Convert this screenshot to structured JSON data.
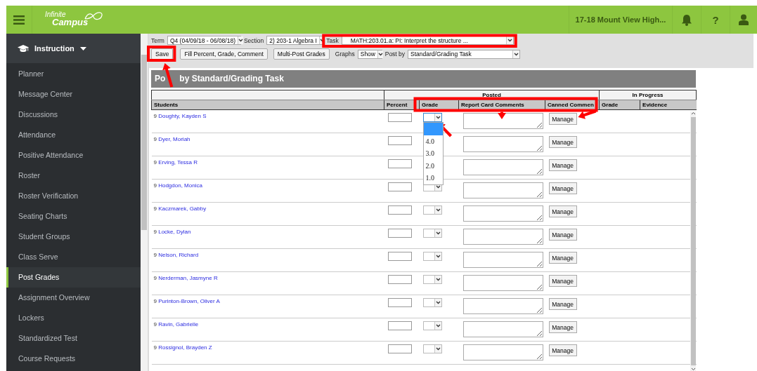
{
  "header": {
    "logo_lines": [
      "Infinite",
      "Campus"
    ],
    "school": "17-18 Mount View High...",
    "help": "?"
  },
  "sidebar": {
    "module": "Instruction",
    "items": [
      {
        "label": "Planner",
        "selected": false
      },
      {
        "label": "Message Center",
        "selected": false
      },
      {
        "label": "Discussions",
        "selected": false
      },
      {
        "label": "Attendance",
        "selected": false
      },
      {
        "label": "Positive Attendance",
        "selected": false
      },
      {
        "label": "Roster",
        "selected": false
      },
      {
        "label": "Roster Verification",
        "selected": false
      },
      {
        "label": "Seating Charts",
        "selected": false
      },
      {
        "label": "Student Groups",
        "selected": false
      },
      {
        "label": "Class Serve",
        "selected": false
      },
      {
        "label": "Post Grades",
        "selected": true
      },
      {
        "label": "Assignment Overview",
        "selected": false
      },
      {
        "label": "Lockers",
        "selected": false
      },
      {
        "label": "Standardized Test",
        "selected": false
      },
      {
        "label": "Course Requests",
        "selected": false
      }
    ]
  },
  "toolbar": {
    "term": {
      "label": "Term",
      "value": "Q4 (04/09/18 - 06/08/18)"
    },
    "section": {
      "label": "Section",
      "value": "2) 203-1 Algebra I"
    },
    "task": {
      "label": "Task",
      "value": "MATH:203.01.a: PI: Interpret the structure ..."
    },
    "buttons": [
      "Save",
      "Fill Percent, Grade, Comment",
      "Multi-Post Grades"
    ],
    "graphs": {
      "label": "Graphs",
      "value": "Show"
    },
    "post_by": {
      "label": "Post by",
      "value": "Standard/Grading Task"
    }
  },
  "panel": {
    "title_parts": [
      "Po",
      "by Standard/Grading Task"
    ],
    "group_headers": [
      "Posted",
      "In Progress"
    ],
    "columns": [
      "Students",
      "Percent",
      "Grade",
      "Report Card Comments",
      "Canned Commen",
      "Grade",
      "Evidence"
    ],
    "rows": [
      {
        "grade_level": "9",
        "name": "Doughty, Kayden S",
        "grade": {
          "open": true,
          "blank_selected": true,
          "options": [
            {
              "label": "4.0",
              "selected": false
            },
            {
              "label": "3.0",
              "selected": false
            },
            {
              "label": "2.0",
              "selected": false
            },
            {
              "label": "1.0",
              "selected": false
            }
          ]
        },
        "manage": "Manage"
      },
      {
        "grade_level": "9",
        "name": "Dyer, Moriah",
        "manage": "Manage"
      },
      {
        "grade_level": "9",
        "name": "Erving, Tessa R",
        "manage": "Manage"
      },
      {
        "grade_level": "9",
        "name": "Hodgdon, Monica",
        "grade": {
          "open": false
        },
        "manage": "Manage"
      },
      {
        "grade_level": "9",
        "name": "Kaczmarek, Gabby",
        "grade": {
          "open": false
        },
        "manage": "Manage"
      },
      {
        "grade_level": "9",
        "name": "Locke, Dylan",
        "grade": {
          "open": false
        },
        "manage": "Manage"
      },
      {
        "grade_level": "9",
        "name": "Nelson, Richard",
        "grade": {
          "open": false
        },
        "manage": "Manage"
      },
      {
        "grade_level": "9",
        "name": "Nerderman, Jasmyne R",
        "grade": {
          "open": false
        },
        "manage": "Manage"
      },
      {
        "grade_level": "9",
        "name": "Purinton-Brown, Oliver A",
        "grade": {
          "open": false
        },
        "manage": "Manage"
      },
      {
        "grade_level": "9",
        "name": "Ravin, Gabrielle",
        "grade": {
          "open": false
        },
        "manage": "Manage"
      },
      {
        "grade_level": "9",
        "name": "Rossignol, Brayden Z",
        "grade": {
          "open": false
        },
        "manage": "Manage"
      }
    ]
  }
}
